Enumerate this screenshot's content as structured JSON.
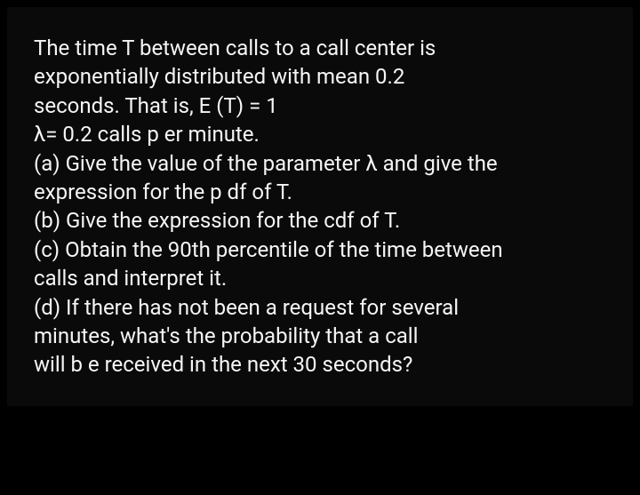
{
  "problem": {
    "intro_line1": "The time T between calls to a call center is",
    "intro_line2": "exponentially distributed with mean 0.2",
    "intro_line3": "seconds. That is, E (T) = 1",
    "intro_line4": "λ= 0.2 calls p er minute.",
    "part_a_line1": "(a) Give the value of the parameter λ and give the",
    "part_a_line2": "expression for the p df of T.",
    "part_b_line1": "(b) Give the expression for the cdf of T.",
    "part_c_line1": "(c) Obtain the 90th percentile of the time between",
    "part_c_line2": "calls and interpret it.",
    "part_d_line1": "(d) If there has not been a request for several",
    "part_d_line2": "minutes, what's the probability that a call",
    "part_d_line3": "will b e received in the next 30 seconds?"
  }
}
